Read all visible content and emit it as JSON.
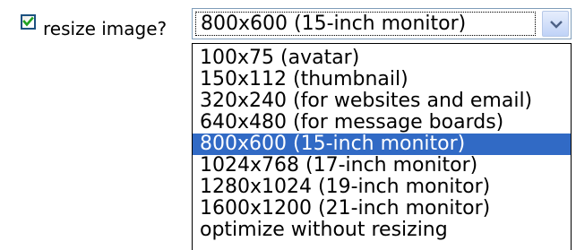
{
  "resize_checkbox": {
    "checked": true,
    "label": "resize image?"
  },
  "size_select": {
    "selected_value": "800x600 (15-inch monitor)",
    "options": [
      {
        "label": "100x75 (avatar)"
      },
      {
        "label": "150x112 (thumbnail)"
      },
      {
        "label": "320x240 (for websites and email)"
      },
      {
        "label": "640x480 (for message boards)"
      },
      {
        "label": "800x600 (15-inch monitor)",
        "selected": true
      },
      {
        "label": "1024x768 (17-inch monitor)"
      },
      {
        "label": "1280x1024 (19-inch monitor)"
      },
      {
        "label": "1600x1200 (21-inch monitor)"
      },
      {
        "label": "optimize without resizing"
      }
    ]
  },
  "icons": {
    "checkmark": "checkmark-icon",
    "dropdown_arrow": "chevron-down-icon"
  },
  "colors": {
    "selection_background": "#316ac5",
    "checkmark": "#21a121",
    "control_border": "#7f9db9",
    "dropdown_button_top": "#e6eefc",
    "dropdown_button_bottom": "#c0d3f7",
    "dropdown_arrow": "#4d6185"
  }
}
